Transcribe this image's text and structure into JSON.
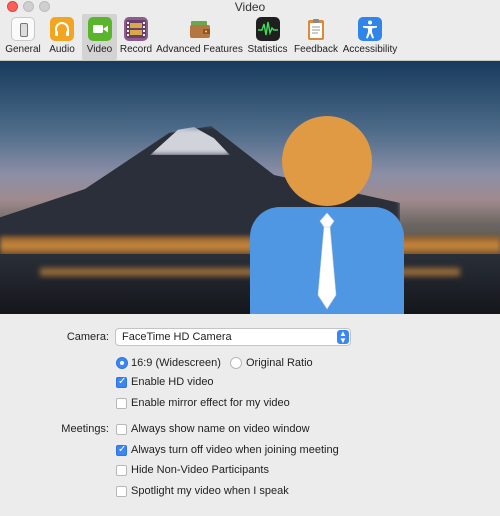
{
  "window": {
    "title": "Video"
  },
  "toolbar": {
    "items": [
      {
        "label": "General",
        "icon": "switch-icon",
        "color": "#ffffff"
      },
      {
        "label": "Audio",
        "icon": "headphones-icon",
        "color": "#f2a520"
      },
      {
        "label": "Video",
        "icon": "video-camera-icon",
        "color": "#5ab52c",
        "active": true
      },
      {
        "label": "Record",
        "icon": "film-icon",
        "color": "#8e5b8d"
      },
      {
        "label": "Advanced Features",
        "icon": "wallet-icon",
        "color": "#6a8a3a"
      },
      {
        "label": "Statistics",
        "icon": "waveform-icon",
        "color": "#1f1f1f"
      },
      {
        "label": "Feedback",
        "icon": "clipboard-icon",
        "color": "#d98a3a"
      },
      {
        "label": "Accessibility",
        "icon": "accessibility-icon",
        "color": "#2f86e8"
      }
    ]
  },
  "settings": {
    "camera_label": "Camera:",
    "camera_value": "FaceTime HD Camera",
    "aspect_widescreen": "16:9 (Widescreen)",
    "aspect_original": "Original Ratio",
    "enable_hd": "Enable HD video",
    "mirror": "Enable mirror effect for my video",
    "meetings_label": "Meetings:",
    "show_name": "Always show name on video window",
    "turn_off_video": "Always turn off video when joining meeting",
    "hide_non_video": "Hide Non-Video Participants",
    "spotlight": "Spotlight my video when I speak"
  },
  "state": {
    "aspect": "widescreen",
    "enable_hd": true,
    "mirror": false,
    "show_name": false,
    "turn_off_video": true,
    "hide_non_video": false,
    "spotlight": false
  },
  "colors": {
    "accent": "#3b86f5",
    "avatar_head": "#e09a44",
    "avatar_body": "#4f97e3"
  }
}
